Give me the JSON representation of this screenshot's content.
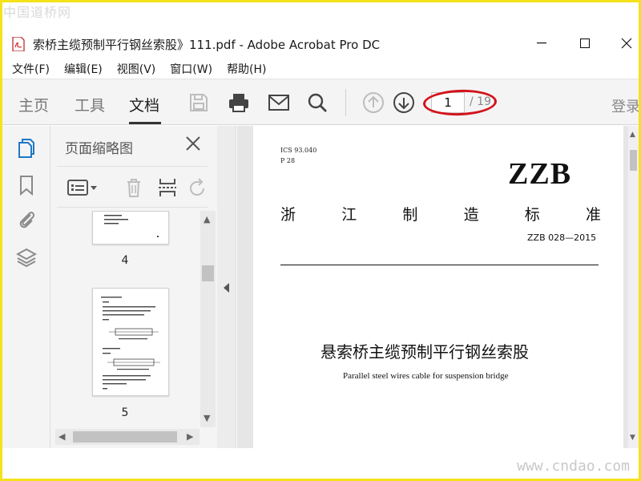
{
  "watermark": {
    "top": "中国道桥网",
    "bottom": "www.cndao.com"
  },
  "window": {
    "title": "索桥主缆预制平行钢丝索股》111.pdf - Adobe Acrobat Pro DC"
  },
  "menu": {
    "items": [
      "文件(F)",
      "编辑(E)",
      "视图(V)",
      "窗口(W)",
      "帮助(H)"
    ]
  },
  "toolbar": {
    "tabs": [
      "主页",
      "工具",
      "文档"
    ],
    "active_tab": "文档",
    "page_current": "1",
    "page_total": "/ 19",
    "login": "登录",
    "icons": [
      "save-icon",
      "print-icon",
      "email-icon",
      "search-icon",
      "page-up-icon",
      "page-down-icon"
    ],
    "annotation_color": "#d3121b"
  },
  "sidebar": {
    "rail_icons": [
      "page-thumbnails-icon",
      "bookmark-icon",
      "attachment-icon",
      "layers-icon"
    ],
    "panel_title": "页面缩略图",
    "tools": [
      "page-options-icon",
      "delete-icon",
      "extract-icon",
      "rotate-icon"
    ],
    "thumbnails": [
      {
        "label": "4"
      },
      {
        "label": "5"
      }
    ]
  },
  "document": {
    "ics": "ICS 93.040",
    "code": "P 28",
    "brand": "ZZB",
    "standard_line": [
      "浙",
      "江",
      "制",
      "造",
      "标",
      "准"
    ],
    "standard_number": "ZZB 028—2015",
    "title_cn": "悬索桥主缆预制平行钢丝索股",
    "title_en": "Parallel steel wires cable for suspension bridge"
  },
  "colors": {
    "accent": "#1f78c8",
    "frame": "#f5e21a"
  }
}
